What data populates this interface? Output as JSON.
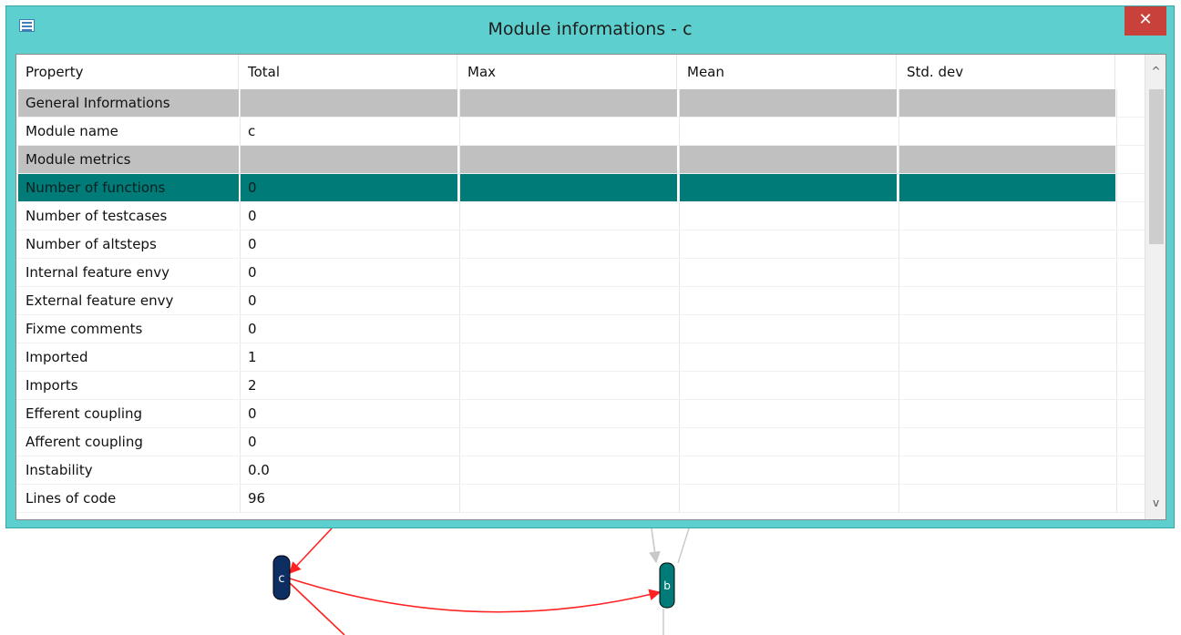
{
  "window": {
    "title": "Module informations - c",
    "close_glyph": "✕"
  },
  "table": {
    "columns": [
      "Property",
      "Total",
      "Max",
      "Mean",
      "Std. dev"
    ],
    "rows": [
      {
        "cells": [
          "General Informations",
          "",
          "",
          "",
          ""
        ],
        "kind": "group"
      },
      {
        "cells": [
          "Module name",
          "c",
          "",
          "",
          ""
        ],
        "kind": "normal"
      },
      {
        "cells": [
          "Module metrics",
          "",
          "",
          "",
          ""
        ],
        "kind": "group"
      },
      {
        "cells": [
          "Number of functions",
          "0",
          "",
          "",
          ""
        ],
        "kind": "selected"
      },
      {
        "cells": [
          "Number of testcases",
          "0",
          "",
          "",
          ""
        ],
        "kind": "normal"
      },
      {
        "cells": [
          "Number of altsteps",
          "0",
          "",
          "",
          ""
        ],
        "kind": "normal"
      },
      {
        "cells": [
          "Internal feature envy",
          "0",
          "",
          "",
          ""
        ],
        "kind": "normal"
      },
      {
        "cells": [
          "External feature envy",
          "0",
          "",
          "",
          ""
        ],
        "kind": "normal"
      },
      {
        "cells": [
          "Fixme comments",
          "0",
          "",
          "",
          ""
        ],
        "kind": "normal"
      },
      {
        "cells": [
          "Imported",
          "1",
          "",
          "",
          ""
        ],
        "kind": "normal"
      },
      {
        "cells": [
          "Imports",
          "2",
          "",
          "",
          ""
        ],
        "kind": "normal"
      },
      {
        "cells": [
          "Efferent coupling",
          "0",
          "",
          "",
          ""
        ],
        "kind": "normal"
      },
      {
        "cells": [
          "Afferent coupling",
          "0",
          "",
          "",
          ""
        ],
        "kind": "normal"
      },
      {
        "cells": [
          "Instability",
          "0.0",
          "",
          "",
          ""
        ],
        "kind": "normal"
      },
      {
        "cells": [
          "Lines of code",
          "96",
          "",
          "",
          ""
        ],
        "kind": "normal"
      }
    ]
  },
  "scrollbar": {
    "up_glyph": "^",
    "down_glyph": "v"
  },
  "graph": {
    "nodes": [
      {
        "id": "c",
        "label": "c",
        "color": "#0d2e63"
      },
      {
        "id": "b",
        "label": "b",
        "color": "#007b78"
      }
    ],
    "edge_color_red": "#ff2222",
    "edge_color_gray": "#c8c8c8"
  },
  "colors": {
    "window_frame": "#5ecfcf",
    "close_button": "#c8413b",
    "group_row": "#c0c0c0",
    "selected_row": "#007b78"
  }
}
